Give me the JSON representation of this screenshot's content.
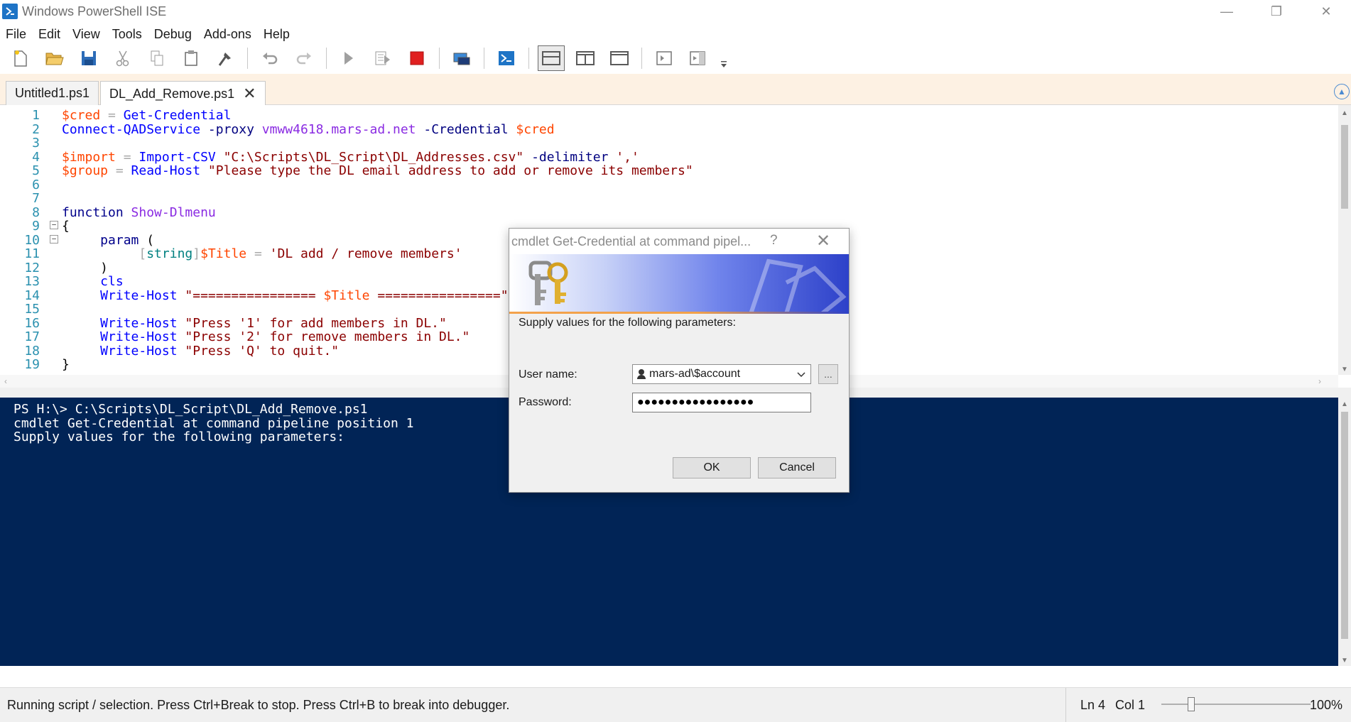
{
  "window": {
    "title": "Windows PowerShell ISE",
    "minimize_glyph": "—",
    "restore_glyph": "❐",
    "close_glyph": "✕"
  },
  "menu": [
    "File",
    "Edit",
    "View",
    "Tools",
    "Debug",
    "Add-ons",
    "Help"
  ],
  "toolbar": {
    "icons": [
      "new-file-icon",
      "open-folder-icon",
      "save-icon",
      "cut-icon",
      "copy-icon",
      "paste-icon",
      "clear-console-icon",
      "undo-icon",
      "redo-icon",
      "run-script-icon",
      "run-selection-icon",
      "stop-icon",
      "remote-powershell-icon",
      "powershell-console-icon",
      "show-script-top-icon",
      "show-script-right-icon",
      "show-script-maximized-icon",
      "show-command-window-icon",
      "show-command-addon-icon",
      "toolbar-overflow-icon"
    ]
  },
  "tabs": [
    {
      "label": "Untitled1.ps1",
      "active": false
    },
    {
      "label": "DL_Add_Remove.ps1",
      "active": true,
      "close": "✕"
    }
  ],
  "editor": {
    "lines": [
      {
        "n": "1",
        "fold": "",
        "tokens": [
          [
            "var",
            "$cred"
          ],
          [
            "op",
            " = "
          ],
          [
            "cmd",
            "Get-Credential"
          ]
        ]
      },
      {
        "n": "2",
        "fold": "",
        "tokens": [
          [
            "cmd",
            "Connect-QADService"
          ],
          [
            "prm",
            " -proxy "
          ],
          [
            "fn",
            "vmww4618.mars-ad.net"
          ],
          [
            "prm",
            " -Credential "
          ],
          [
            "var",
            "$cred"
          ]
        ]
      },
      {
        "n": "3",
        "fold": "",
        "tokens": []
      },
      {
        "n": "4",
        "fold": "",
        "tokens": [
          [
            "var",
            "$import"
          ],
          [
            "op",
            " = "
          ],
          [
            "cmd",
            "Import-CSV"
          ],
          [
            "str",
            " \"C:\\Scripts\\DL_Script\\DL_Addresses.csv\""
          ],
          [
            "prm",
            " -delimiter "
          ],
          [
            "str",
            "','"
          ]
        ]
      },
      {
        "n": "5",
        "fold": "",
        "tokens": [
          [
            "var",
            "$group"
          ],
          [
            "op",
            " = "
          ],
          [
            "cmd",
            "Read-Host"
          ],
          [
            "str",
            " \"Please type the DL email address to add or remove its members\""
          ]
        ]
      },
      {
        "n": "6",
        "fold": "",
        "tokens": []
      },
      {
        "n": "7",
        "fold": "",
        "tokens": []
      },
      {
        "n": "8",
        "fold": "",
        "tokens": [
          [
            "kw",
            "function "
          ],
          [
            "fn",
            "Show-Dlmenu"
          ]
        ]
      },
      {
        "n": "9",
        "fold": "−",
        "tokens": [
          [
            "plain",
            "{"
          ]
        ]
      },
      {
        "n": "10",
        "fold": "−",
        "tokens": [
          [
            "kw",
            "     param "
          ],
          [
            "plain",
            "("
          ]
        ]
      },
      {
        "n": "11",
        "fold": "",
        "tokens": [
          [
            "plain",
            "          "
          ],
          [
            "op",
            "["
          ],
          [
            "typ",
            "string"
          ],
          [
            "op",
            "]"
          ],
          [
            "var",
            "$Title"
          ],
          [
            "op",
            " = "
          ],
          [
            "str",
            "'DL add / remove members'"
          ]
        ]
      },
      {
        "n": "12",
        "fold": "",
        "tokens": [
          [
            "plain",
            "     )"
          ]
        ]
      },
      {
        "n": "13",
        "fold": "",
        "tokens": [
          [
            "cmd",
            "     cls"
          ]
        ]
      },
      {
        "n": "14",
        "fold": "",
        "tokens": [
          [
            "cmd",
            "     Write-Host "
          ],
          [
            "str",
            "\"================ "
          ],
          [
            "var",
            "$Title"
          ],
          [
            "str",
            " ================\""
          ]
        ]
      },
      {
        "n": "15",
        "fold": "",
        "tokens": []
      },
      {
        "n": "16",
        "fold": "",
        "tokens": [
          [
            "cmd",
            "     Write-Host "
          ],
          [
            "str",
            "\"Press '1' for add members in DL.\""
          ]
        ]
      },
      {
        "n": "17",
        "fold": "",
        "tokens": [
          [
            "cmd",
            "     Write-Host "
          ],
          [
            "str",
            "\"Press '2' for remove members in DL.\""
          ]
        ]
      },
      {
        "n": "18",
        "fold": "",
        "tokens": [
          [
            "cmd",
            "     Write-Host "
          ],
          [
            "str",
            "\"Press 'Q' to quit.\""
          ]
        ]
      },
      {
        "n": "19",
        "fold": "",
        "tokens": [
          [
            "plain",
            "}"
          ]
        ]
      }
    ]
  },
  "console": {
    "lines": [
      "PS H:\\> C:\\Scripts\\DL_Script\\DL_Add_Remove.ps1",
      "cmdlet Get-Credential at command pipeline position 1",
      "Supply values for the following parameters:"
    ]
  },
  "status": {
    "message": "Running script / selection.  Press Ctrl+Break to stop.  Press Ctrl+B to break into debugger.",
    "ln": "Ln 4",
    "col": "Col 1",
    "zoom": "100%"
  },
  "dialog": {
    "title": "cmdlet Get-Credential at command pipel...",
    "help": "?",
    "close": "✕",
    "prompt": "Supply values for the following parameters:",
    "username_label": "User name:",
    "username_value": "mars-ad\\$account",
    "password_label": "Password:",
    "password_mask": "●●●●●●●●●●●●●●●●●",
    "browse_label": "...",
    "ok_label": "OK",
    "cancel_label": "Cancel"
  },
  "colors": {
    "console_bg": "#012456",
    "tab_strip_bg": "#fdf1e3",
    "accent_blue": "#2d41c9",
    "accent_orange": "#f3a24a"
  }
}
